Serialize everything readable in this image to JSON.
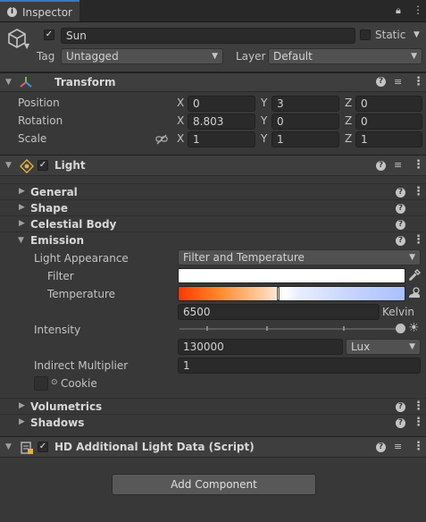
{
  "tab": {
    "title": "Inspector"
  },
  "gameobject": {
    "name": "Sun",
    "static_label": "Static",
    "tag_label": "Tag",
    "tag_value": "Untagged",
    "layer_label": "Layer",
    "layer_value": "Default"
  },
  "transform": {
    "title": "Transform",
    "rows": [
      {
        "label": "Position",
        "x": "0",
        "y": "3",
        "z": "0"
      },
      {
        "label": "Rotation",
        "x": "8.803",
        "y": "0",
        "z": "0"
      },
      {
        "label": "Scale",
        "x": "1",
        "y": "1",
        "z": "1"
      }
    ],
    "axes": [
      "X",
      "Y",
      "Z"
    ]
  },
  "light": {
    "title": "Light",
    "sections": {
      "general": "General",
      "shape": "Shape",
      "celestial": "Celestial Body",
      "emission": "Emission",
      "volumetrics": "Volumetrics",
      "shadows": "Shadows"
    },
    "emission": {
      "appearance_label": "Light Appearance",
      "appearance_value": "Filter and Temperature",
      "filter_label": "Filter",
      "temperature_label": "Temperature",
      "temperature_value": "6500",
      "temperature_unit": "Kelvin",
      "intensity_label": "Intensity",
      "intensity_value": "130000",
      "intensity_unit": "Lux",
      "indirect_label": "Indirect Multiplier",
      "indirect_value": "1",
      "cookie_label": "Cookie"
    }
  },
  "hd": {
    "title": "HD Additional Light Data (Script)"
  },
  "add_component": "Add Component",
  "colors": {
    "accent": "#3a79bb",
    "panel": "#383838",
    "field": "#2a2a2a"
  }
}
